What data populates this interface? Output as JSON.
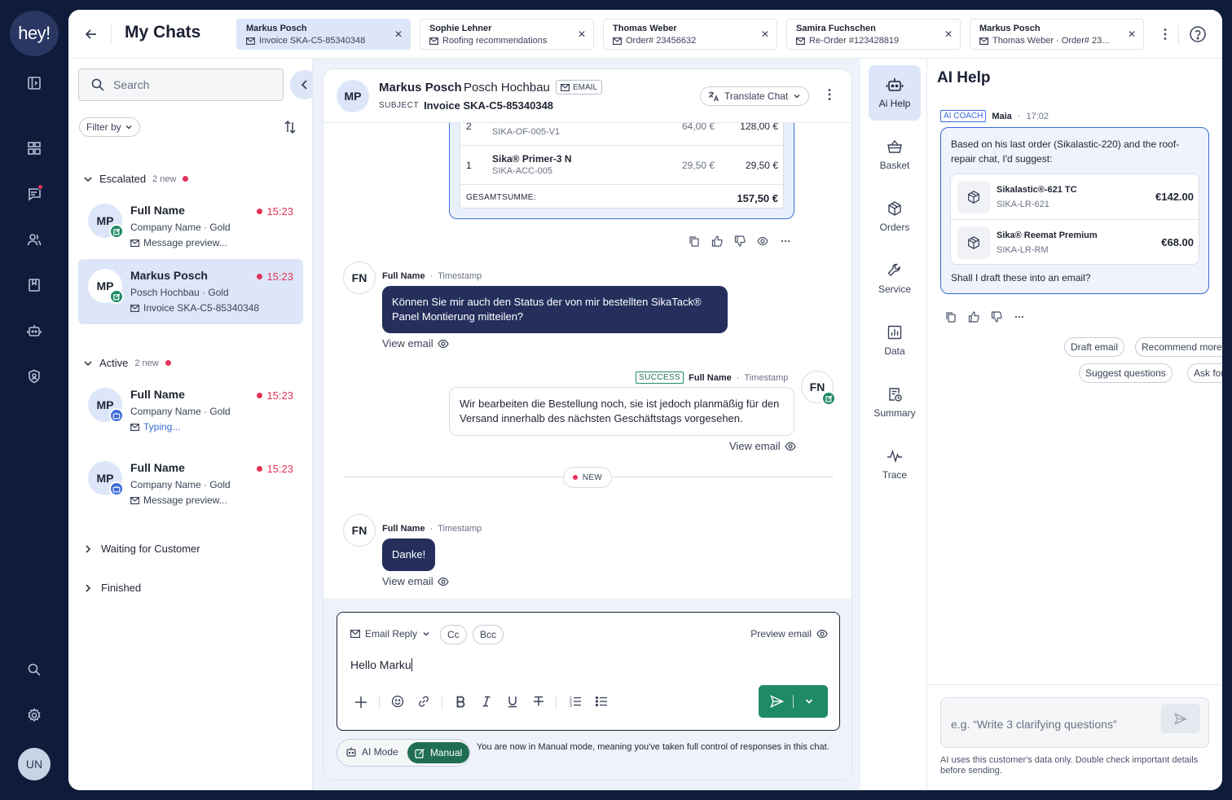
{
  "rail": {
    "logo": "hey!",
    "user_initials": "UN"
  },
  "topbar": {
    "title": "My Chats",
    "tabs": [
      {
        "name": "Markus Posch",
        "subtitle": "Invoice SKA-C5-85340348",
        "active": true
      },
      {
        "name": "Sophie Lehner",
        "subtitle": "Roofing recommendations",
        "active": false
      },
      {
        "name": "Thomas Weber",
        "subtitle": "Order# 23456632",
        "active": false
      },
      {
        "name": "Samira Fuchschen",
        "subtitle": "Re-Order #123428819",
        "active": false
      },
      {
        "name": "Markus Posch",
        "subtitle": "Thomas Weber · Order# 23...",
        "active": false
      }
    ]
  },
  "sidebar": {
    "search_placeholder": "Search",
    "filter_label": "Filter by",
    "groups": {
      "escalated": {
        "label": "Escalated",
        "count": "2 new"
      },
      "active": {
        "label": "Active",
        "count": "2 new"
      },
      "waiting": {
        "label": "Waiting for Customer"
      },
      "finished": {
        "label": "Finished"
      }
    },
    "chats": [
      {
        "initials": "MP",
        "name": "Full Name",
        "time": "15:23",
        "company": "Company Name · Gold",
        "preview": "Message preview..."
      },
      {
        "initials": "MP",
        "name": "Markus Posch",
        "time": "15:23",
        "company": "Posch Hochbau · Gold",
        "preview": "Invoice SKA-C5-85340348"
      },
      {
        "initials": "MP",
        "name": "Full Name",
        "time": "15:23",
        "company": "Company Name · Gold",
        "preview": "Typing..."
      },
      {
        "initials": "MP",
        "name": "Full Name",
        "time": "15:23",
        "company": "Company Name · Gold",
        "preview": "Message preview..."
      }
    ]
  },
  "chat": {
    "header": {
      "initials": "MP",
      "name": "Markus Posch",
      "company": "Posch Hochbau",
      "channel": "EMAIL",
      "subject_label": "SUBJECT",
      "subject": "Invoice SKA-C5-85340348",
      "translate": "Translate Chat"
    },
    "invoice": {
      "rows": [
        {
          "qty": "2",
          "name": "",
          "sku": "SIKA-OF-005-V1",
          "unit": "64,00 €",
          "total": "128,00 €"
        },
        {
          "qty": "1",
          "name": "Sika® Primer-3 N",
          "sku": "SIKA-ACC-005",
          "unit": "29,50 €",
          "total": "29,50 €"
        }
      ],
      "total_label": "GESAMTSUMME:",
      "total": "157,50 €"
    },
    "messages": [
      {
        "initials": "FN",
        "name": "Full Name",
        "timestamp": "Timestamp",
        "text": "Können Sie mir auch den Status der von mir bestellten SikaTack® Panel Montierung mitteilen?",
        "view": "View email"
      },
      {
        "initials": "FN",
        "status": "SUCCESS",
        "name": "Full Name",
        "timestamp": "Timestamp",
        "text": "Wir bearbeiten die Bestellung noch, sie ist jedoch planmäßig für den Versand innerhalb des nächsten Geschäftstags vorgesehen.",
        "view": "View email"
      },
      {
        "initials": "FN",
        "name": "Full Name",
        "timestamp": "Timestamp",
        "text": "Danke!",
        "view": "View email"
      }
    ],
    "new_divider": "NEW",
    "composer": {
      "reply_type": "Email Reply",
      "cc": "Cc",
      "bcc": "Bcc",
      "preview": "Preview email",
      "draft": "Hello Marku"
    },
    "mode": {
      "ai": "AI Mode",
      "manual": "Manual",
      "note": "You are now in Manual mode, meaning you've taken full control of responses in this chat."
    }
  },
  "tools": [
    {
      "label": "Ai Help",
      "icon": "robot-icon"
    },
    {
      "label": "Basket",
      "icon": "basket-icon"
    },
    {
      "label": "Orders",
      "icon": "box-icon"
    },
    {
      "label": "Service",
      "icon": "wrench-icon"
    },
    {
      "label": "Data",
      "icon": "chart-icon"
    },
    {
      "label": "Summary",
      "icon": "summary-icon"
    },
    {
      "label": "Trace",
      "icon": "pulse-icon"
    }
  ],
  "ai_help": {
    "title": "AI Help",
    "badge": "AI COACH",
    "agent": "Maia",
    "time": "17:02",
    "text": "Based on his last order (Sikalastic-220) and the roof-repair chat, I'd suggest:",
    "products": [
      {
        "name": "Sikalastic®-621 TC",
        "sku": "SIKA-LR-621",
        "price": "€142.00"
      },
      {
        "name": "Sika® Reemat Premium",
        "sku": "SIKA-LR-RM",
        "price": "€68.00"
      }
    ],
    "question": "Shall I draft these into an email?",
    "chips": [
      "Draft email",
      "Recommend more products",
      "Suggest questions",
      "Ask for a budget"
    ],
    "input_placeholder": "e.g. “Write 3 clarifying questions”",
    "disclaimer": "AI uses this customer's data only. Double check important details before sending."
  },
  "colors": {
    "rail_bg": "#0f1b3a",
    "accent_blue": "#3b6bd8",
    "selected_bg": "#dce6f8",
    "dark_bubble": "#242f5c",
    "success_green": "#1f8a67",
    "alert_red": "#e5335b"
  }
}
